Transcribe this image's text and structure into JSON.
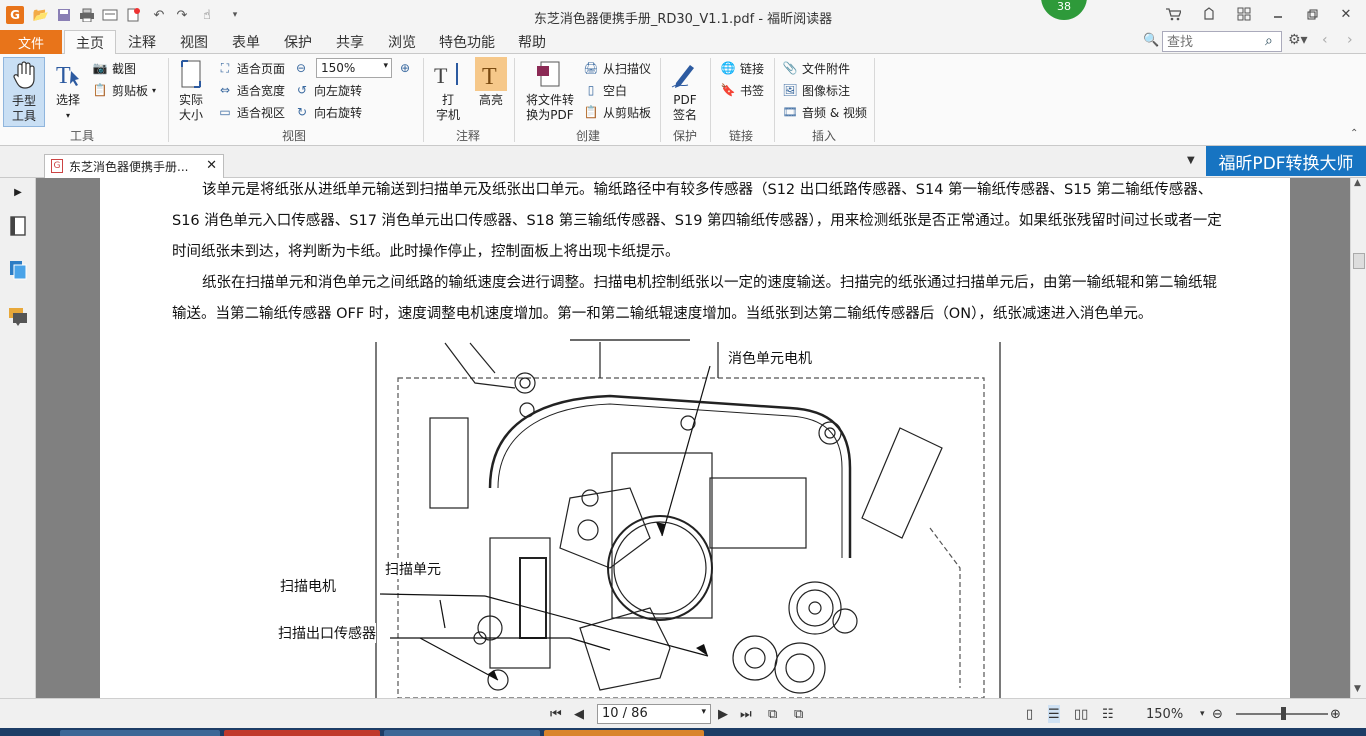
{
  "window": {
    "title": "东芝消色器便携手册_RD30_V1.1.pdf - 福昕阅读器",
    "badge": "38"
  },
  "ribbon_tabs": {
    "file": "文件",
    "tabs": [
      "主页",
      "注释",
      "视图",
      "表单",
      "保护",
      "共享",
      "浏览",
      "特色功能",
      "帮助"
    ],
    "active": "主页"
  },
  "search": {
    "placeholder": "查找"
  },
  "ribbon": {
    "tools": {
      "hand": "手型\n工具",
      "select": "选择",
      "screenshot": "截图",
      "clipboard": "剪贴板",
      "group": "工具"
    },
    "view": {
      "actual_size": "实际\n大小",
      "fit_page": "适合页面",
      "fit_width": "适合宽度",
      "fit_visible": "适合视区",
      "zoom": "150%",
      "rotate_left": "向左旋转",
      "rotate_right": "向右旋转",
      "group": "视图"
    },
    "comment": {
      "typewriter": "打\n字机",
      "highlight": "高亮",
      "group": "注释"
    },
    "create": {
      "convert": "将文件转\n换为PDF",
      "from_scanner": "从扫描仪",
      "blank": "空白",
      "from_clipboard": "从剪贴板",
      "group": "创建"
    },
    "protect": {
      "sign": "PDF\n签名",
      "group": "保护"
    },
    "links": {
      "link": "链接",
      "bookmark": "书签",
      "group": "链接"
    },
    "insert": {
      "attachment": "文件附件",
      "image": "图像标注",
      "media": "音频 & 视频",
      "group": "插入"
    }
  },
  "doc_tab": {
    "label": "东芝消色器便携手册..."
  },
  "promo": "福昕PDF转换大师",
  "document": {
    "para1": "该单元是将纸张从进纸单元输送到扫描单元及纸张出口单元。输纸路径中有较多传感器（S12 出口纸路传感器、S14 第一输纸传感器、S15 第二输纸传感器、S16 消色单元入口传感器、S17 消色单元出口传感器、S18 第三输纸传感器、S19 第四输纸传感器），用来检测纸张是否正常通过。如果纸张残留时间过长或者一定时间纸张未到达，将判断为卡纸。此时操作停止，控制面板上将出现卡纸提示。",
    "para2": "纸张在扫描单元和消色单元之间纸路的输纸速度会进行调整。扫描电机控制纸张以一定的速度输送。扫描完的纸张通过扫描单元后，由第一输纸辊和第二输纸辊输送。当第二输纸传感器 OFF 时，速度调整电机速度增加。第一和第二输纸辊速度增加。当纸张到达第二输纸传感器后（ON），纸张减速进入消色单元。",
    "diagram_labels": {
      "erase_motor": "消色单元电机",
      "scan_unit": "扫描单元",
      "scan_motor": "扫描电机",
      "scan_exit_sensor": "扫描出口传感器"
    }
  },
  "status": {
    "page": "10 / 86",
    "zoom": "150%"
  }
}
